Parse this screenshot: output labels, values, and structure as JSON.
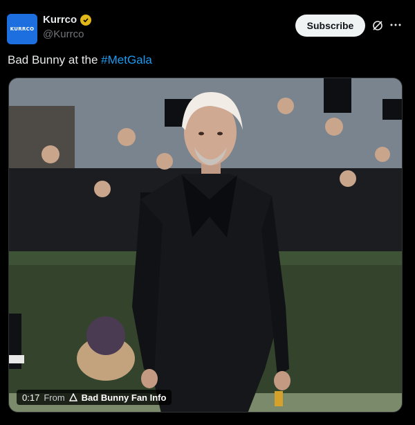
{
  "author": {
    "display_name": "Kurrco",
    "handle": "@Kurrco",
    "avatar_text": "KURRCO",
    "verified_color": "#e2b719",
    "avatar_color": "#1d6fe0"
  },
  "actions": {
    "subscribe_label": "Subscribe",
    "grok_icon": "grok-icon",
    "more_icon": "more-icon"
  },
  "post": {
    "text_prefix": "Bad Bunny at the ",
    "hashtag": "#MetGala"
  },
  "media": {
    "timestamp": "0:17",
    "from_label": "From",
    "source_name": "Bad Bunny Fan Info"
  },
  "colors": {
    "background": "#000000",
    "link": "#1d9bf0",
    "muted": "#71767b"
  }
}
